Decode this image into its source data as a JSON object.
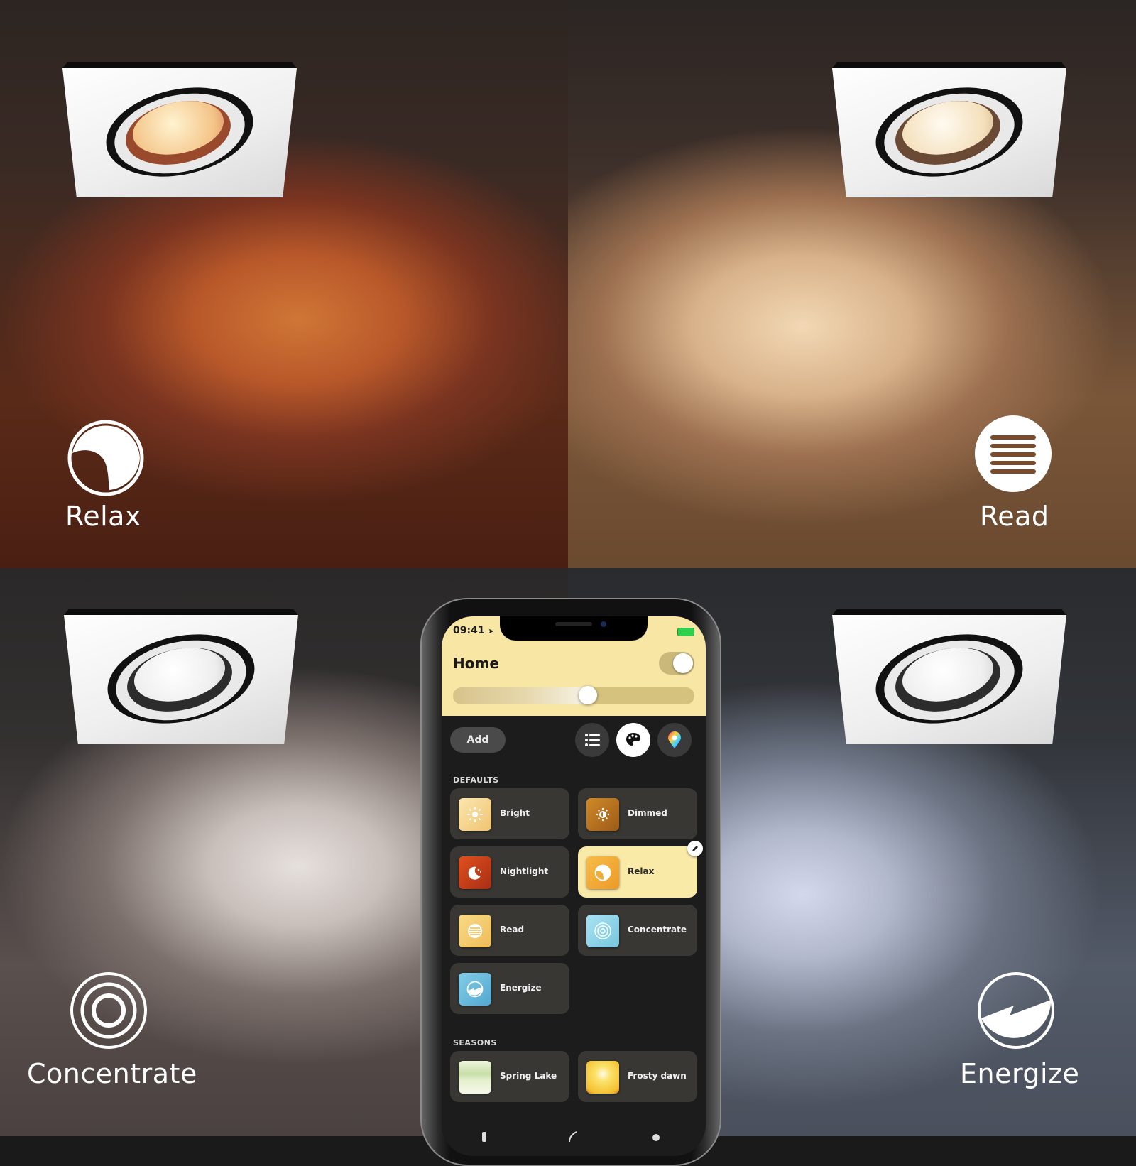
{
  "scenes": [
    {
      "id": "relax",
      "label": "Relax",
      "icon": "relax-icon"
    },
    {
      "id": "read",
      "label": "Read",
      "icon": "read-icon"
    },
    {
      "id": "concentrate",
      "label": "Concentrate",
      "icon": "concentrate-icon"
    },
    {
      "id": "energize",
      "label": "Energize",
      "icon": "energize-icon"
    }
  ],
  "phone": {
    "status_bar": {
      "time": "09:41",
      "location_icon": "location-arrow-icon",
      "battery_icon": "battery-charging-icon"
    },
    "room": {
      "title": "Home",
      "power_on": true,
      "brightness_percent": 56
    },
    "toolbar": {
      "add_label": "Add",
      "buttons": [
        {
          "name": "list-view",
          "icon": "list-icon",
          "active": false
        },
        {
          "name": "scene-palette",
          "icon": "palette-icon",
          "active": true
        },
        {
          "name": "color-picker",
          "icon": "color-pin-icon",
          "active": false
        }
      ]
    },
    "sections": [
      {
        "title": "DEFAULTS",
        "scenes": [
          {
            "label": "Bright",
            "icon": "sun-icon",
            "color": "#f3d48a",
            "selected": false
          },
          {
            "label": "Dimmed",
            "icon": "dim-sun-icon",
            "color": "#b87420",
            "selected": false
          },
          {
            "label": "Nightlight",
            "icon": "moon-icon",
            "color": "#c8401a",
            "selected": false
          },
          {
            "label": "Relax",
            "icon": "relax-icon",
            "color": "#f2a838",
            "selected": true
          },
          {
            "label": "Read",
            "icon": "read-icon",
            "color": "#f3cc72",
            "selected": false
          },
          {
            "label": "Concentrate",
            "icon": "concentrate-icon",
            "color": "#8fd4e8",
            "selected": false
          },
          {
            "label": "Energize",
            "icon": "energize-icon",
            "color": "#6cbadc",
            "selected": false
          }
        ]
      },
      {
        "title": "SEASONS",
        "scenes": [
          {
            "label": "Spring Lake",
            "icon": "spring-lake-image",
            "color": "#dfeec8",
            "selected": false
          },
          {
            "label": "Frosty dawn",
            "icon": "frosty-dawn-image",
            "color": "#f7d040",
            "selected": false
          }
        ]
      }
    ],
    "edit_icon": "pencil-icon"
  },
  "colors": {
    "header_bg": "#f7e6a4",
    "screen_bg": "#1c1c1c",
    "selected_tile": "#faeaa8",
    "relax_light": "#d07636",
    "read_light": "#f2d8b4",
    "concentrate_light": "#e6e0dc",
    "energize_light": "#d4d8ec"
  }
}
